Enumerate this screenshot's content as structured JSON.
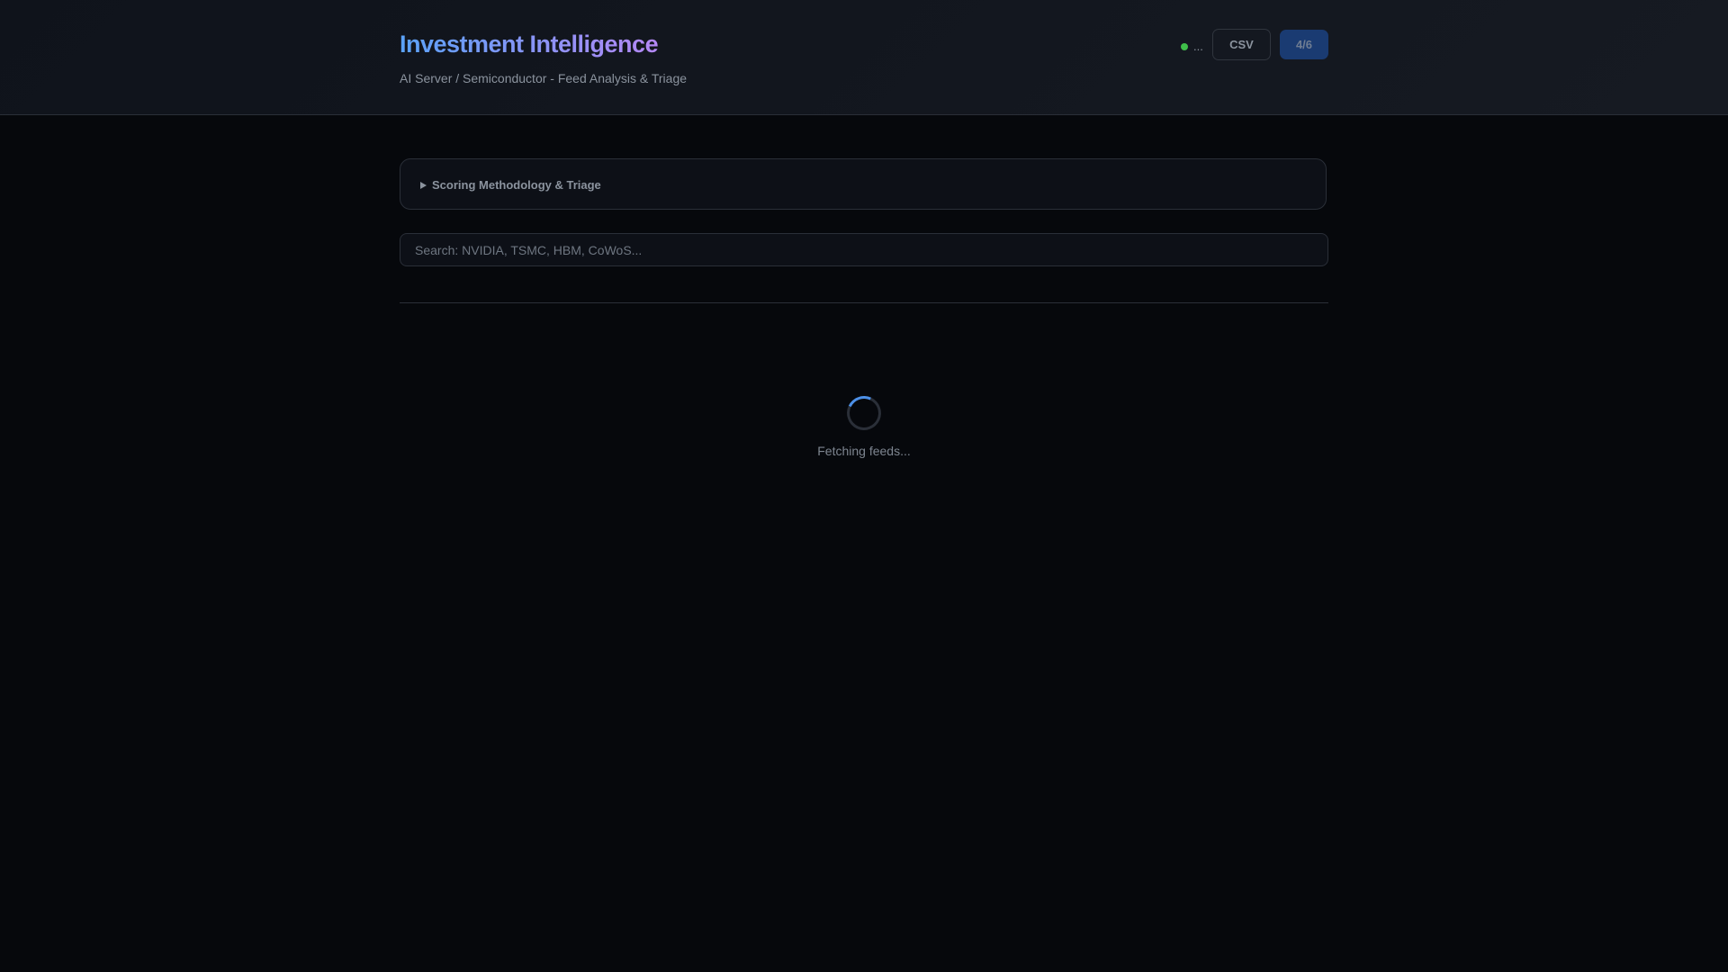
{
  "header": {
    "title": "Investment Intelligence",
    "subtitle": "AI Server / Semiconductor - Feed Analysis & Triage",
    "status_text": "...",
    "status_color": "#3fbf4a",
    "csv_label": "CSV",
    "progress_label": "4/6"
  },
  "methodology": {
    "summary": "Scoring Methodology & Triage"
  },
  "search": {
    "placeholder": "Search: NVIDIA, TSMC, HBM, CoWoS...",
    "value": ""
  },
  "loading": {
    "text": "Fetching feeds..."
  }
}
